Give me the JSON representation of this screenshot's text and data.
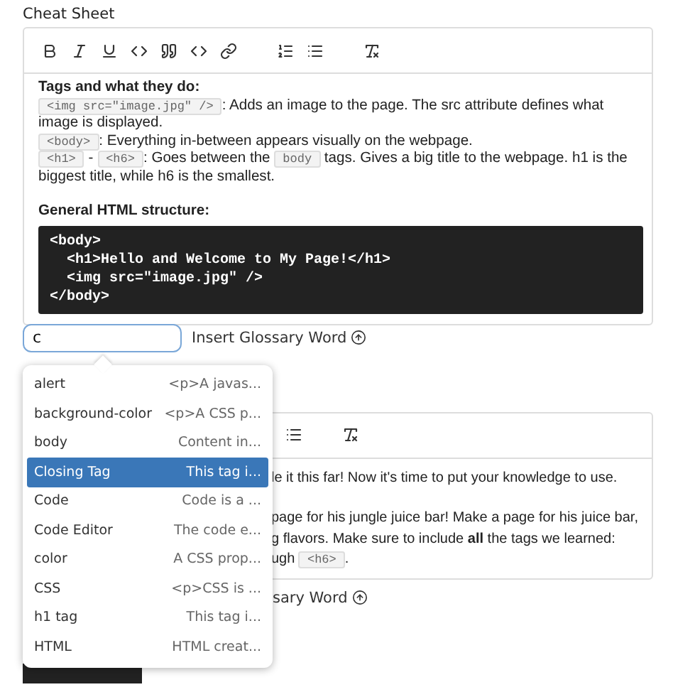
{
  "label": "Cheat Sheet",
  "editor": {
    "sections": [
      {
        "heading": "Tags and what they do:",
        "paragraphs": [
          [
            {
              "kind": "code",
              "text": "<img src=\"image.jpg\" />"
            },
            {
              "kind": "text",
              "text": ": Adds an image to the page. The src attribute defines what image is displayed."
            }
          ],
          [
            {
              "kind": "code",
              "text": "<body>"
            },
            {
              "kind": "text",
              "text": ": Everything in-between appears visually on the webpage."
            }
          ],
          [
            {
              "kind": "code",
              "text": "<h1>"
            },
            {
              "kind": "text",
              "text": " - "
            },
            {
              "kind": "code",
              "text": "<h6>"
            },
            {
              "kind": "text",
              "text": ": Goes between the "
            },
            {
              "kind": "code",
              "text": "body"
            },
            {
              "kind": "text",
              "text": " tags. Gives a big title to the webpage. h1 is the biggest title, while h6 is the smallest."
            }
          ]
        ]
      },
      {
        "heading": "General HTML structure:",
        "code_block": [
          "<body>",
          "  <h1>Hello and Welcome to My Page!</h1>",
          "  <img src=\"image.jpg\" />",
          "</body>"
        ]
      }
    ]
  },
  "glossary_input": {
    "value": "c",
    "button": "Insert Glossary Word"
  },
  "dropdown": [
    {
      "label": "alert",
      "description": "<p>A javas...",
      "selected": false
    },
    {
      "label": "background-color",
      "description": "<p>A CSS p...",
      "selected": false
    },
    {
      "label": "body",
      "description": "Content in...",
      "selected": false
    },
    {
      "label": "Closing Tag",
      "description": "This tag i...",
      "selected": true
    },
    {
      "label": "Code",
      "description": "Code is a ...",
      "selected": false
    },
    {
      "label": "Code Editor",
      "description": "The code e...",
      "selected": false
    },
    {
      "label": "color",
      "description": "A CSS prop...",
      "selected": false
    },
    {
      "label": "CSS",
      "description": "<p>CSS is ...",
      "selected": false
    },
    {
      "label": "h1 tag",
      "description": "This tag i...",
      "selected": false
    },
    {
      "label": "HTML",
      "description": "HTML creat...",
      "selected": false
    }
  ],
  "second_editor": {
    "lines": [
      [
        {
          "kind": "text",
          "text": "le it this far! Now it's time to put your knowledge to use."
        }
      ],
      [
        {
          "kind": "text",
          "text": "page for his jungle juice bar! Make a page for his juice bar,"
        }
      ],
      [
        {
          "kind": "text",
          "text": "g flavors. Make sure to include **all** the tags we learned:"
        }
      ],
      [
        {
          "kind": "text",
          "text": "ugh "
        },
        {
          "kind": "code",
          "text": "<h6>"
        },
        {
          "kind": "text",
          "text": "."
        }
      ]
    ],
    "button": "sary Word"
  }
}
